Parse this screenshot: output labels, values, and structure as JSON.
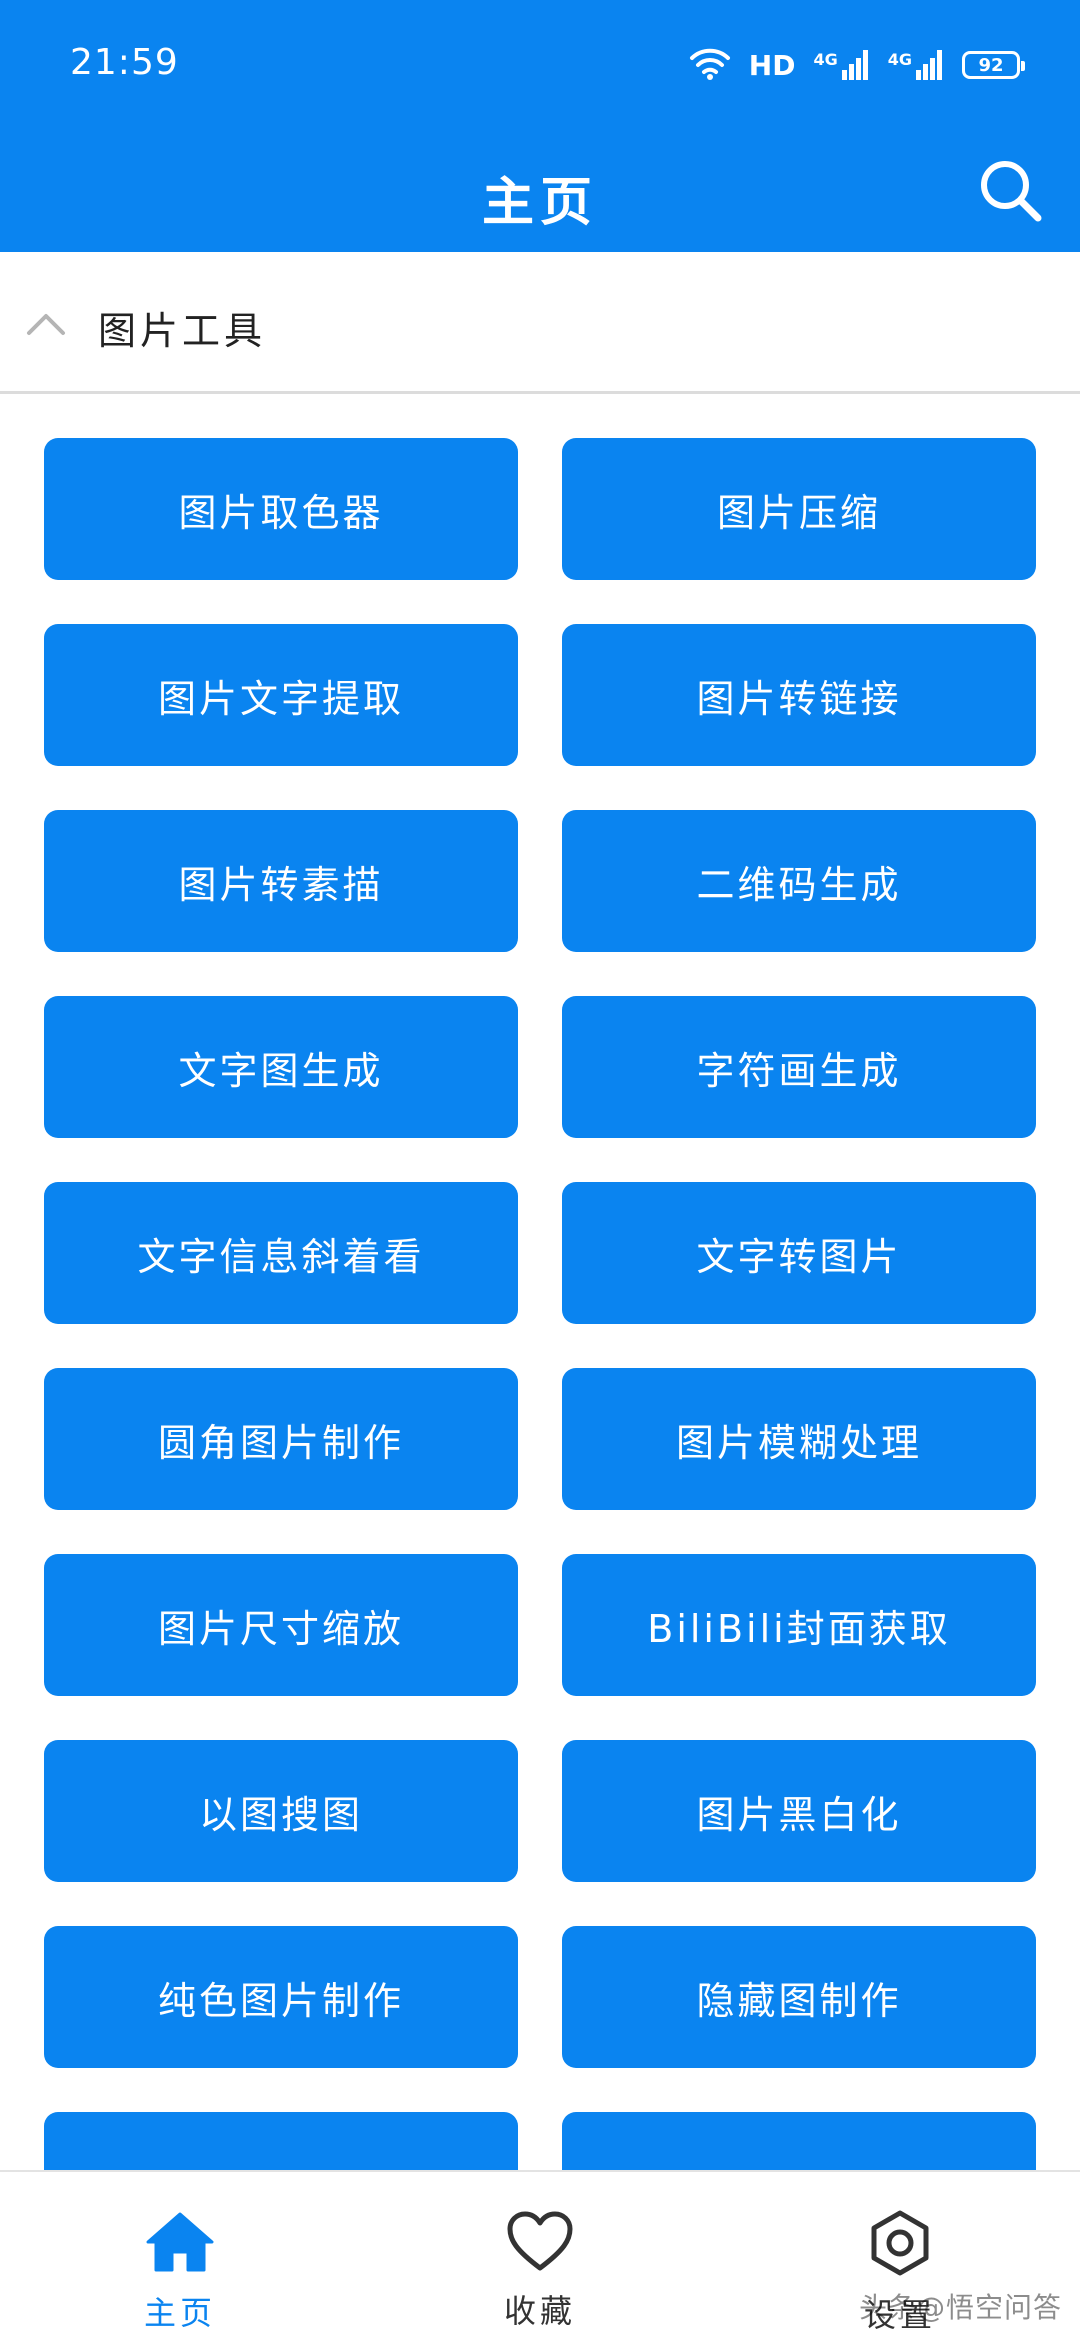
{
  "status_bar": {
    "time": "21:59",
    "hd_label": "HD",
    "network_1": "4G",
    "network_2": "4G",
    "battery": "92"
  },
  "app_bar": {
    "title": "主页"
  },
  "section": {
    "title": "图片工具",
    "expanded": true
  },
  "tools": [
    "图片取色器",
    "图片压缩",
    "图片文字提取",
    "图片转链接",
    "图片转素描",
    "二维码生成",
    "文字图生成",
    "字符画生成",
    "文字信息斜着看",
    "文字转图片",
    "圆角图片制作",
    "图片模糊处理",
    "图片尺寸缩放",
    "BiliBili封面获取",
    "以图搜图",
    "图片黑白化",
    "纯色图片制作",
    "隐藏图制作",
    "",
    ""
  ],
  "bottom_nav": {
    "items": [
      {
        "label": "主页",
        "icon": "home-icon",
        "active": true
      },
      {
        "label": "收藏",
        "icon": "heart-icon",
        "active": false
      },
      {
        "label": "设置",
        "icon": "settings-icon",
        "active": false
      }
    ],
    "watermark": "头条@悟空问答"
  },
  "colors": {
    "primary": "#0a84f0",
    "text_dark": "#222222",
    "divider": "#dcdcdc"
  }
}
